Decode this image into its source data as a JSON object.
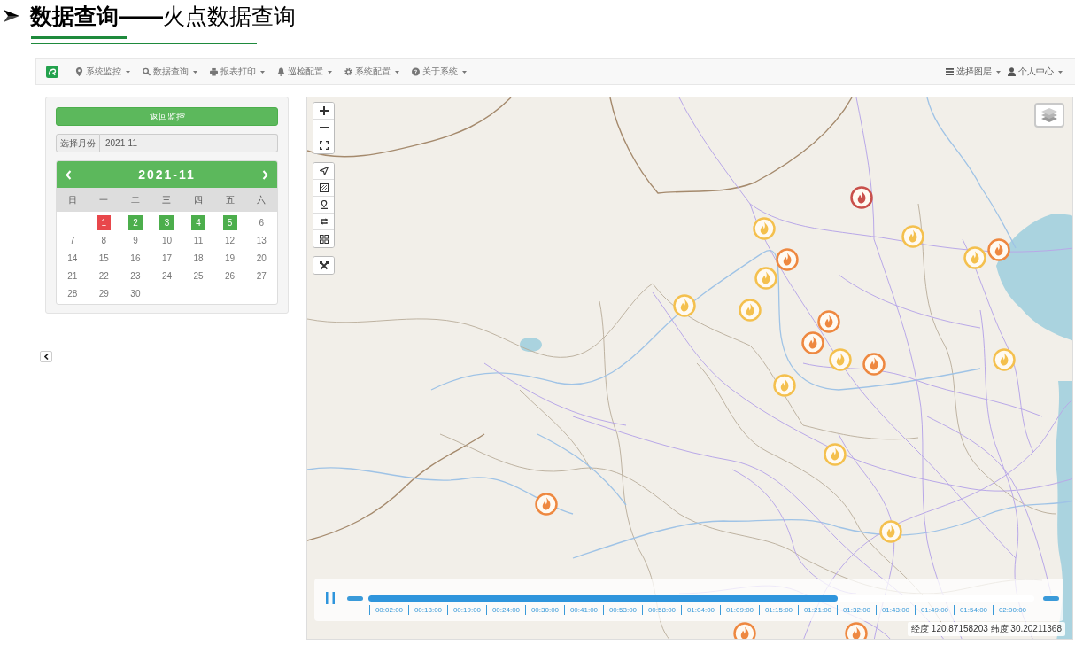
{
  "header": {
    "title": "**数据查询——**火点数据查询"
  },
  "navbar": {
    "left_menus": [
      "系统监控",
      "数据查询",
      "报表打印",
      "巡检配置",
      "系统配置",
      "关于系统"
    ],
    "right_menus": [
      "选择图层",
      "个人中心"
    ]
  },
  "panel": {
    "back_button": "返回监控",
    "month_picker": {
      "label": "选择月份",
      "value": "2021-11"
    },
    "calendar": {
      "title": "2021-11",
      "weekdays": [
        "日",
        "一",
        "二",
        "三",
        "四",
        "五",
        "六"
      ],
      "weeks": [
        {
          "days": [
            {
              "day": "1",
              "color": "#e8474b"
            },
            {
              "day": "2",
              "color": "#4cae4c"
            },
            {
              "day": "3",
              "color": "#4cae4c"
            },
            {
              "day": "4",
              "color": "#4cae4c"
            },
            {
              "day": "5",
              "color": "#4cae4c"
            },
            {
              "day": "6"
            }
          ]
        },
        {
          "days": [
            {
              "day": "7"
            },
            {
              "day": "8"
            },
            {
              "day": "9"
            },
            {
              "day": "10"
            },
            {
              "day": "11"
            },
            {
              "day": "12"
            },
            {
              "day": "13"
            }
          ]
        },
        {
          "days": [
            {
              "day": "14"
            },
            {
              "day": "15"
            },
            {
              "day": "16"
            },
            {
              "day": "17"
            },
            {
              "day": "18"
            },
            {
              "day": "19"
            },
            {
              "day": "20"
            }
          ]
        },
        {
          "days": [
            {
              "day": "21"
            },
            {
              "day": "22"
            },
            {
              "day": "23"
            },
            {
              "day": "24"
            },
            {
              "day": "25"
            },
            {
              "day": "26"
            },
            {
              "day": "27"
            }
          ]
        },
        {
          "days": [
            {
              "day": "28"
            },
            {
              "day": "29"
            },
            {
              "day": "30"
            }
          ]
        }
      ]
    }
  },
  "map": {
    "fire_markers": [
      {
        "color": "#c9504b"
      },
      {
        "color": "#f4c04e"
      },
      {
        "color": "#f4c04e"
      },
      {
        "color": "#ee8840"
      },
      {
        "color": "#f4c04e"
      },
      {
        "color": "#ee8840"
      },
      {
        "color": "#f4c04e"
      },
      {
        "color": "#f4c04e"
      },
      {
        "color": "#f4c04e"
      },
      {
        "color": "#ee8840"
      },
      {
        "color": "#ee8840"
      },
      {
        "color": "#f4c04e"
      },
      {
        "color": "#ee8840"
      },
      {
        "color": "#f4c04e"
      },
      {
        "color": "#f4c04e"
      },
      {
        "color": "#f4c04e"
      },
      {
        "color": "#ee8840"
      },
      {
        "color": "#f4c04e"
      },
      {
        "color": "#ee8840"
      },
      {
        "color": "#ee8840"
      }
    ],
    "timeline": {
      "playing": true,
      "level": 0.705,
      "ticks": [
        "00:02:00",
        "00:13:00",
        "00:19:00",
        "00:24:00",
        "00:30:00",
        "00:41:00",
        "00:53:00",
        "00:58:00",
        "01:04:00",
        "01:09:00",
        "01:15:00",
        "01:21:00",
        "01:32:00",
        "01:43:00",
        "01:49:00",
        "01:54:00",
        "02:00:00"
      ]
    },
    "coordinates": "经度 120.87158203 纬度 30.20211368"
  }
}
